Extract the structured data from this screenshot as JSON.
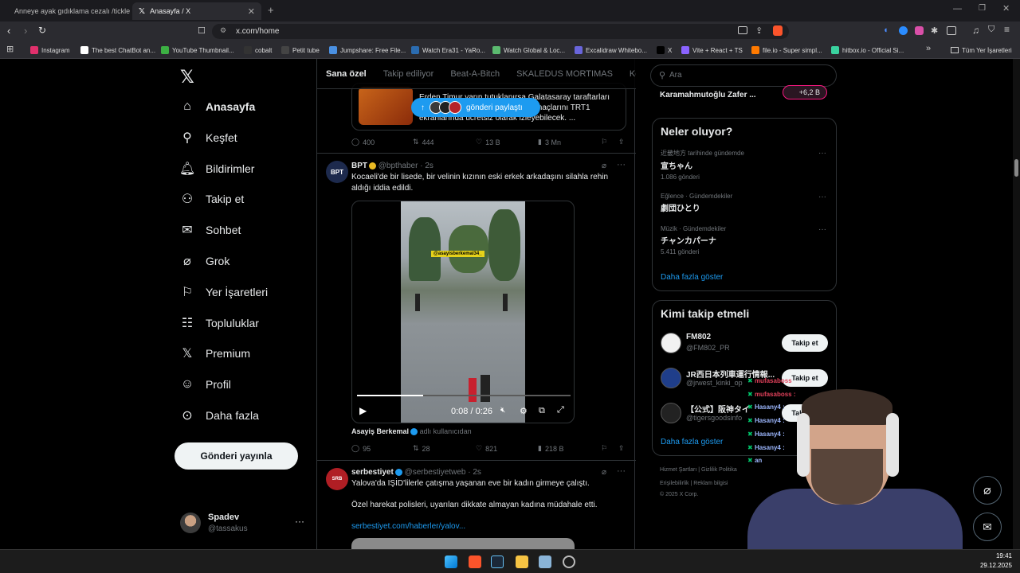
{
  "browser": {
    "tabs": [
      {
        "title": "Anneye ayak gıdıklama cezalı /tickle"
      },
      {
        "title": "Anasayfa / X"
      }
    ],
    "url": "x.com/home",
    "bookmarks": [
      {
        "label": "Instagram",
        "color": "#e1306c"
      },
      {
        "label": "The best ChatBot an...",
        "color": "#ffffff"
      },
      {
        "label": "YouTube Thumbnail...",
        "color": "#3cb043"
      },
      {
        "label": "cobalt",
        "color": "#333333"
      },
      {
        "label": "Petit tube",
        "color": "#444444"
      },
      {
        "label": "Jumpshare: Free File...",
        "color": "#4a90e2"
      },
      {
        "label": "Watch Era31 - YaRo...",
        "color": "#2b6cb0"
      },
      {
        "label": "Watch Global & Loc...",
        "color": "#5bba6f"
      },
      {
        "label": "Excalidraw Whitebo...",
        "color": "#6965db"
      },
      {
        "label": "X",
        "color": "#000000"
      },
      {
        "label": "Vite + React + TS",
        "color": "#8a63ff"
      },
      {
        "label": "file.io - Super simpl...",
        "color": "#ff7a00"
      },
      {
        "label": "hitbox.io - Official Si...",
        "color": "#3ad29f"
      }
    ],
    "bookmarks_folder": "Tüm Yer İşaretleri"
  },
  "nav": {
    "items": [
      {
        "label": "Anasayfa",
        "icon": "home-icon"
      },
      {
        "label": "Keşfet",
        "icon": "search-icon"
      },
      {
        "label": "Bildirimler",
        "icon": "bell-icon"
      },
      {
        "label": "Takip et",
        "icon": "add-user-icon"
      },
      {
        "label": "Sohbet",
        "icon": "mail-icon"
      },
      {
        "label": "Grok",
        "icon": "grok-icon"
      },
      {
        "label": "Yer İşaretleri",
        "icon": "bookmark-icon"
      },
      {
        "label": "Topluluklar",
        "icon": "communities-icon"
      },
      {
        "label": "Premium",
        "icon": "x-icon"
      },
      {
        "label": "Profil",
        "icon": "profile-icon"
      },
      {
        "label": "Daha fazla",
        "icon": "more-icon"
      }
    ],
    "post_button": "Gönderi yayınla",
    "account": {
      "name": "Spadev",
      "handle": "@tassakus"
    }
  },
  "feed": {
    "tabs": [
      "Sana özel",
      "Takip ediliyor",
      "Beat-A-Bitch",
      "SKALEDUS MORTIMAS",
      "Kend"
    ],
    "new_posts_pill": "gönderi paylaştı",
    "top_post": {
      "text_line1": "Erden Timur yarın tutuklanırsa Galatasaray taraftarları",
      "text_line2": "maçlarını TRT1",
      "text_line3": "ekranlarında ücretsiz olarak izleyebilecek. ...",
      "stats": {
        "replies": "400",
        "reposts": "444",
        "likes": "13 B",
        "views": "3 Mn"
      }
    },
    "post1": {
      "name": "BPT",
      "handle": "@bpthaber",
      "time": "2s",
      "text_line1": "Kocaeli'de bir lisede, bir velinin kızının eski erkek arkadaşını silahla rehin",
      "text_line2": "aldığı iddia edildi.",
      "video_watermark": "@asayisberkemal34_",
      "video_time": "0:08 / 0:26",
      "video_progress": 0.31,
      "source_name": "Asayiş Berkemal",
      "source_suffix": "adlı kullanıcıdan",
      "stats": {
        "replies": "95",
        "reposts": "28",
        "likes": "821",
        "views": "218 B"
      }
    },
    "post2": {
      "name": "serbestiyet",
      "handle": "@serbestiyetweb",
      "time": "2s",
      "text1": "Yalova'da IŞİD'lilerle çatışma yaşanan eve bir kadın girmeye çalıştı.",
      "text2": "Özel harekat polisleri, uyarıları dikkate almayan kadına müdahale etti.",
      "link": "serbestiyet.com/haberler/yalov..."
    }
  },
  "right": {
    "search_placeholder": "Ara",
    "top_name": "Karamahmutoğlu Zafer ...",
    "top_badge": "+6,2 B",
    "trends_title": "Neler oluyor?",
    "trends": [
      {
        "context": "近畿地方 tarihinde gündemde",
        "title": "宣ちゃん",
        "count": "1.086 gönderi"
      },
      {
        "context": "Eğlence · Gündemdekiler",
        "title": "劇団ひとり",
        "count": ""
      },
      {
        "context": "Müzik · Gündemdekiler",
        "title": "チャンカパーナ",
        "count": "5.411 gönderi"
      }
    ],
    "trends_more": "Daha fazla göster",
    "who_title": "Kimi takip etmeli",
    "who": [
      {
        "name": "FM802",
        "handle": "@FM802_PR",
        "button": "Takip et"
      },
      {
        "name": "JR西日本列車運行情報...",
        "handle": "@jrwest_kinki_op",
        "button": "Takip et"
      },
      {
        "name": "【公式】阪神タイ",
        "handle": "@tigersgoodsinfo",
        "button": "Takip et"
      }
    ],
    "who_more": "Daha fazla göster",
    "footer_line1": "Hizmet Şartları  |  Gizlilik Politika",
    "footer_line2": "Erişilebilirlik  |  Reklam bilgisi",
    "footer_line3": "© 2025 X Corp."
  },
  "chat": [
    {
      "user": "mufasaboss",
      "color": "#e0405a"
    },
    {
      "user": "mufasaboss :",
      "color": "#e0405a"
    },
    {
      "user": "Hasany4 :",
      "color": "#9db8ff"
    },
    {
      "user": "Hasany4 :",
      "color": "#9db8ff"
    },
    {
      "user": "Hasany4 :",
      "color": "#9db8ff"
    },
    {
      "user": "Hasany4 :",
      "color": "#9db8ff"
    },
    {
      "user": "an",
      "color": "#9db8ff"
    }
  ],
  "taskbar": {
    "time": "19:41",
    "date": "29.12.2025"
  }
}
